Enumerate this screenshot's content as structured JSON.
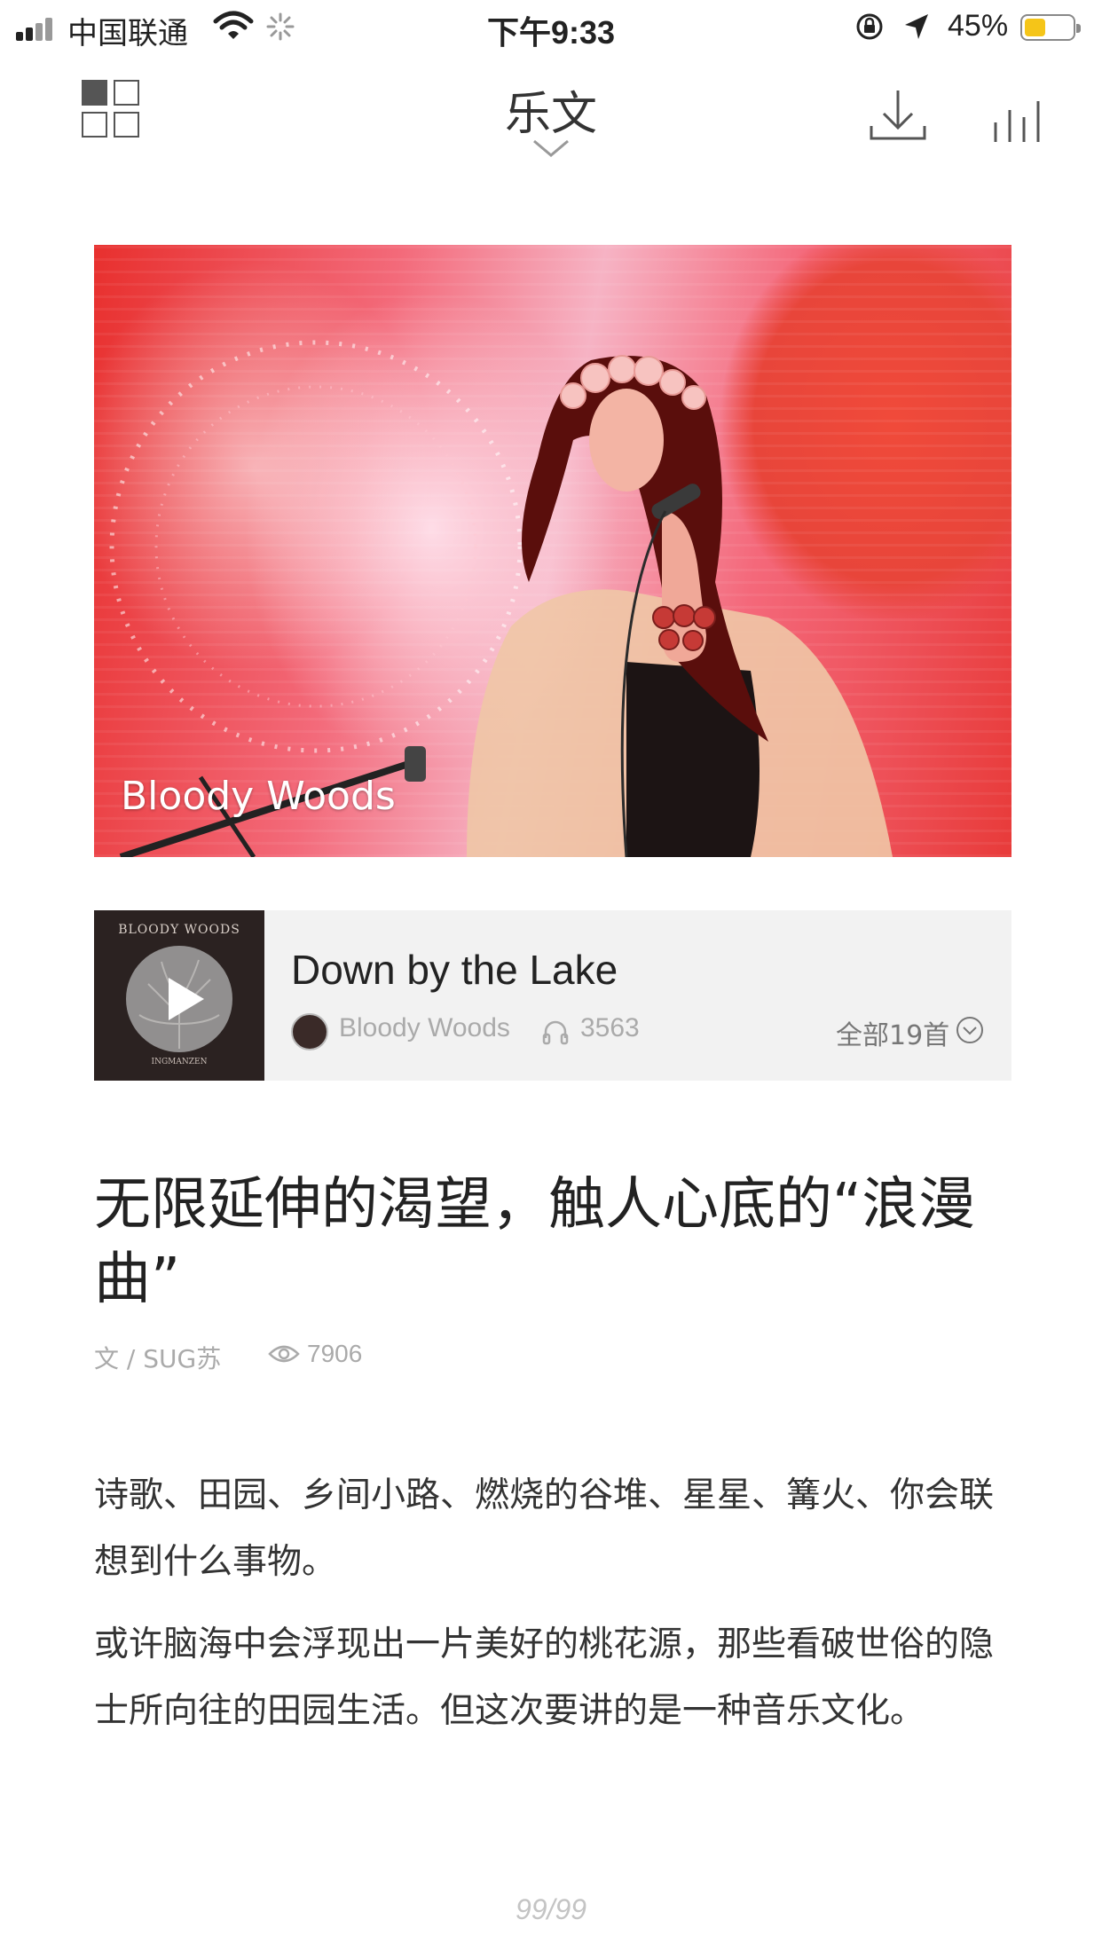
{
  "status_bar": {
    "carrier": "中国联通",
    "time": "下午9:33",
    "battery_percent": "45%",
    "battery_level": 0.45,
    "battery_color": "#f5c518"
  },
  "nav": {
    "title": "乐文",
    "icons": [
      "grid-menu-icon",
      "chevron-down-icon",
      "download-icon",
      "equalizer-icon"
    ]
  },
  "hero": {
    "caption": "Bloody Woods"
  },
  "music_card": {
    "album_cover_text": "BLOODY WOODS",
    "album_cover_subtext": "INGMANZEN",
    "song_title": "Down by the Lake",
    "artist": "Bloody Woods",
    "listen_count": "3563",
    "all_songs_label": "全部19首"
  },
  "article": {
    "headline": "无限延伸的渴望，触人心底的“浪漫曲”",
    "author": "文 / SUG苏",
    "views": "7906",
    "paragraphs": [
      "诗歌、田园、乡间小路、燃烧的谷堆、星星、篝火、你会联想到什么事物。",
      "或许脑海中会浮现出一片美好的桃花源，那些看破世俗的隐士所向往的田园生活。但这次要讲的是一种音乐文化。"
    ]
  },
  "pagination": "99/99"
}
